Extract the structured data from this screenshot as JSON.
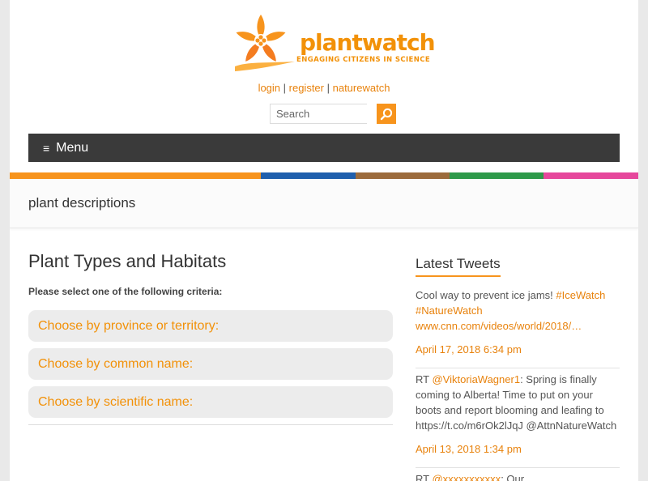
{
  "brand": {
    "name": "plantwatch",
    "tagline": "ENGAGING CITIZENS IN SCIENCE",
    "colors": {
      "accent": "#f29108",
      "menu_bg": "#3a3a3a"
    }
  },
  "toplinks": {
    "login": "login",
    "sep1": " | ",
    "register": "register",
    "sep2": " | ",
    "naturewatch": "naturewatch"
  },
  "search": {
    "placeholder": "Search",
    "icon": "search-icon"
  },
  "menu": {
    "icon": "hamburger-icon",
    "label": "Menu"
  },
  "colorbar": [
    "#f7941d",
    "#1f5fad",
    "#9c6b3c",
    "#2e9a4a",
    "#e6479c"
  ],
  "page_title": "plant descriptions",
  "main": {
    "heading": "Plant Types and Habitats",
    "instruction": "Please select one of the following criteria:",
    "choices": [
      {
        "label": "Choose by province or territory:"
      },
      {
        "label": "Choose by common name:"
      },
      {
        "label": "Choose by scientific name:"
      }
    ]
  },
  "sidebar": {
    "title": "Latest Tweets",
    "tweets": [
      {
        "text": "Cool way to prevent ice jams! ",
        "tag1": "#IceWatch",
        "tag2": "#NatureWatch",
        "link": "www.cnn.com/videos/world/2018/…",
        "date": "April 17, 2018 6:34 pm"
      },
      {
        "prefix": "RT ",
        "mention": "@ViktoriaWagner1",
        "text": ": Spring is finally coming to Alberta! Time to put on your boots and report blooming and leafing to https://t.co/m6rOk2lJqJ @AttnNatureWatch",
        "date": "April 13, 2018 1:34 pm"
      },
      {
        "prefix": "RT ",
        "mention": "@xxxxxxxxxxx",
        "text": ": Our"
      }
    ]
  }
}
